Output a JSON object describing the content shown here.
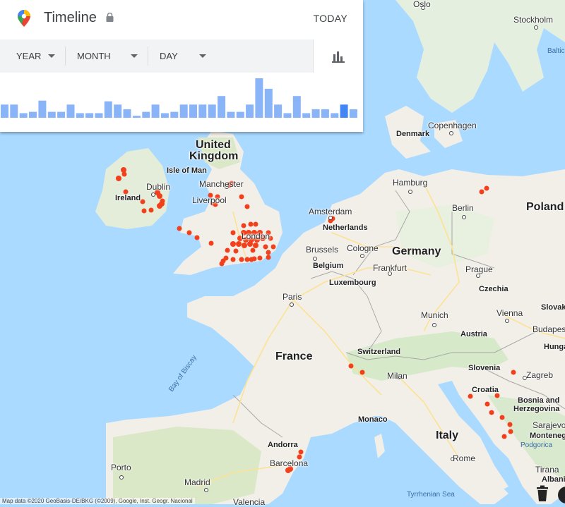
{
  "app": {
    "title": "Timeline",
    "today_label": "TODAY"
  },
  "filters": [
    {
      "label": "YEAR"
    },
    {
      "label": "MONTH"
    },
    {
      "label": "DAY"
    }
  ],
  "histogram": {
    "values": [
      20,
      20,
      7,
      9,
      26,
      9,
      9,
      20,
      7,
      7,
      7,
      25,
      20,
      13,
      3,
      9,
      20,
      7,
      9,
      20,
      20,
      20,
      20,
      33,
      9,
      9,
      20,
      60,
      44,
      20,
      7,
      33,
      7,
      13,
      13,
      7,
      20,
      13
    ],
    "highlight_index": 36,
    "colors": {
      "normal": "#8ab4f8",
      "highlight": "#4285f4"
    }
  },
  "map": {
    "labels": [
      {
        "text": "United",
        "cls": "country"
      },
      {
        "text": "Kingdom",
        "cls": "country"
      },
      {
        "text": "Ireland",
        "cls": "bold"
      },
      {
        "text": "Isle of Man",
        "cls": "bold"
      },
      {
        "text": "Dublin",
        "cls": "city"
      },
      {
        "text": "Manchester",
        "cls": "city"
      },
      {
        "text": "Liverpool",
        "cls": "city"
      },
      {
        "text": "London",
        "cls": "city"
      },
      {
        "text": "Amsterdam",
        "cls": "city"
      },
      {
        "text": "Netherlands",
        "cls": "bold"
      },
      {
        "text": "Brussels",
        "cls": "city"
      },
      {
        "text": "Belgium",
        "cls": "bold"
      },
      {
        "text": "Cologne",
        "cls": "city"
      },
      {
        "text": "Germany",
        "cls": "country"
      },
      {
        "text": "Frankfurt",
        "cls": "city"
      },
      {
        "text": "Luxembourg",
        "cls": "bold"
      },
      {
        "text": "Paris",
        "cls": "city"
      },
      {
        "text": "France",
        "cls": "country"
      },
      {
        "text": "Bay of Biscay",
        "cls": "sea"
      },
      {
        "text": "Switzerland",
        "cls": "bold"
      },
      {
        "text": "Milan",
        "cls": "city"
      },
      {
        "text": "Monaco",
        "cls": "bold"
      },
      {
        "text": "Italy",
        "cls": "country"
      },
      {
        "text": "Rome",
        "cls": "city"
      },
      {
        "text": "Tyrrhenian Sea",
        "cls": "sea"
      },
      {
        "text": "Andorra",
        "cls": "bold"
      },
      {
        "text": "Barcelona",
        "cls": "city"
      },
      {
        "text": "Madrid",
        "cls": "city"
      },
      {
        "text": "Valencia",
        "cls": "city"
      },
      {
        "text": "Porto",
        "cls": "city"
      },
      {
        "text": "Denmark",
        "cls": "bold"
      },
      {
        "text": "Copenhagen",
        "cls": "city"
      },
      {
        "text": "Hamburg",
        "cls": "city"
      },
      {
        "text": "Berlin",
        "cls": "city"
      },
      {
        "text": "Poland",
        "cls": "country"
      },
      {
        "text": "Prague",
        "cls": "city"
      },
      {
        "text": "Czechia",
        "cls": "bold"
      },
      {
        "text": "Munich",
        "cls": "city"
      },
      {
        "text": "Vienna",
        "cls": "city"
      },
      {
        "text": "Austria",
        "cls": "bold"
      },
      {
        "text": "Slovak",
        "cls": "bold"
      },
      {
        "text": "Budapes",
        "cls": "city"
      },
      {
        "text": "Hunga",
        "cls": "bold"
      },
      {
        "text": "Slovenia",
        "cls": "bold"
      },
      {
        "text": "Zagreb",
        "cls": "city"
      },
      {
        "text": "Croatia",
        "cls": "bold"
      },
      {
        "text": "Bosnia and",
        "cls": "bold"
      },
      {
        "text": "Herzegovina",
        "cls": "bold"
      },
      {
        "text": "Sarajevo",
        "cls": "city"
      },
      {
        "text": "Montenegr",
        "cls": "bold"
      },
      {
        "text": "Podgorica",
        "cls": "sea"
      },
      {
        "text": "Tirana",
        "cls": "city"
      },
      {
        "text": "Albani",
        "cls": "bold"
      },
      {
        "text": "Stockholm",
        "cls": "city"
      },
      {
        "text": "Oslo",
        "cls": "city"
      },
      {
        "text": "Baltic",
        "cls": "sea"
      }
    ],
    "copyright": "Map data ©2020 GeoBasis-DE/BKG (©2009), Google, Inst. Geogr. Nacional",
    "colors": {
      "water": "#aadaff",
      "land": "#f2efe9",
      "green": "#cde8c2",
      "visit_dot": "#f2401c",
      "road": "#fde293",
      "border": "#9e9e9e"
    }
  }
}
